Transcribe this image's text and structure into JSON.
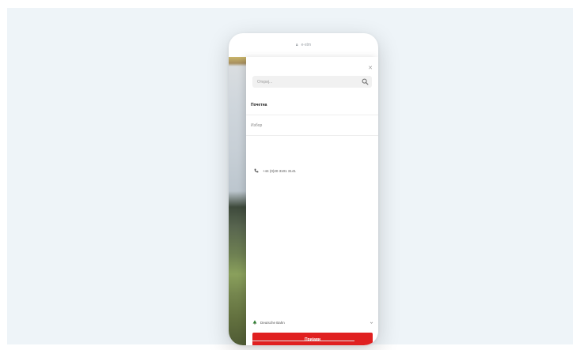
{
  "browser": {
    "url": "e-stm"
  },
  "drawer": {
    "search": {
      "placeholder": "Откриј..."
    },
    "menu": [
      {
        "label": "Почетна"
      },
      {
        "label": "Избор"
      }
    ],
    "phone_number": "+44 (0)20 3101 3141",
    "language_label": "Deutsche Bahn",
    "cta_label": "Пријави"
  },
  "colors": {
    "accent": "#e02020",
    "background": "#eef4f8"
  },
  "icons": {
    "close": "close-icon",
    "search": "search-icon",
    "phone": "phone-icon",
    "language": "tree-icon",
    "chevron": "chevron-down-icon",
    "lock": "lock-icon"
  }
}
